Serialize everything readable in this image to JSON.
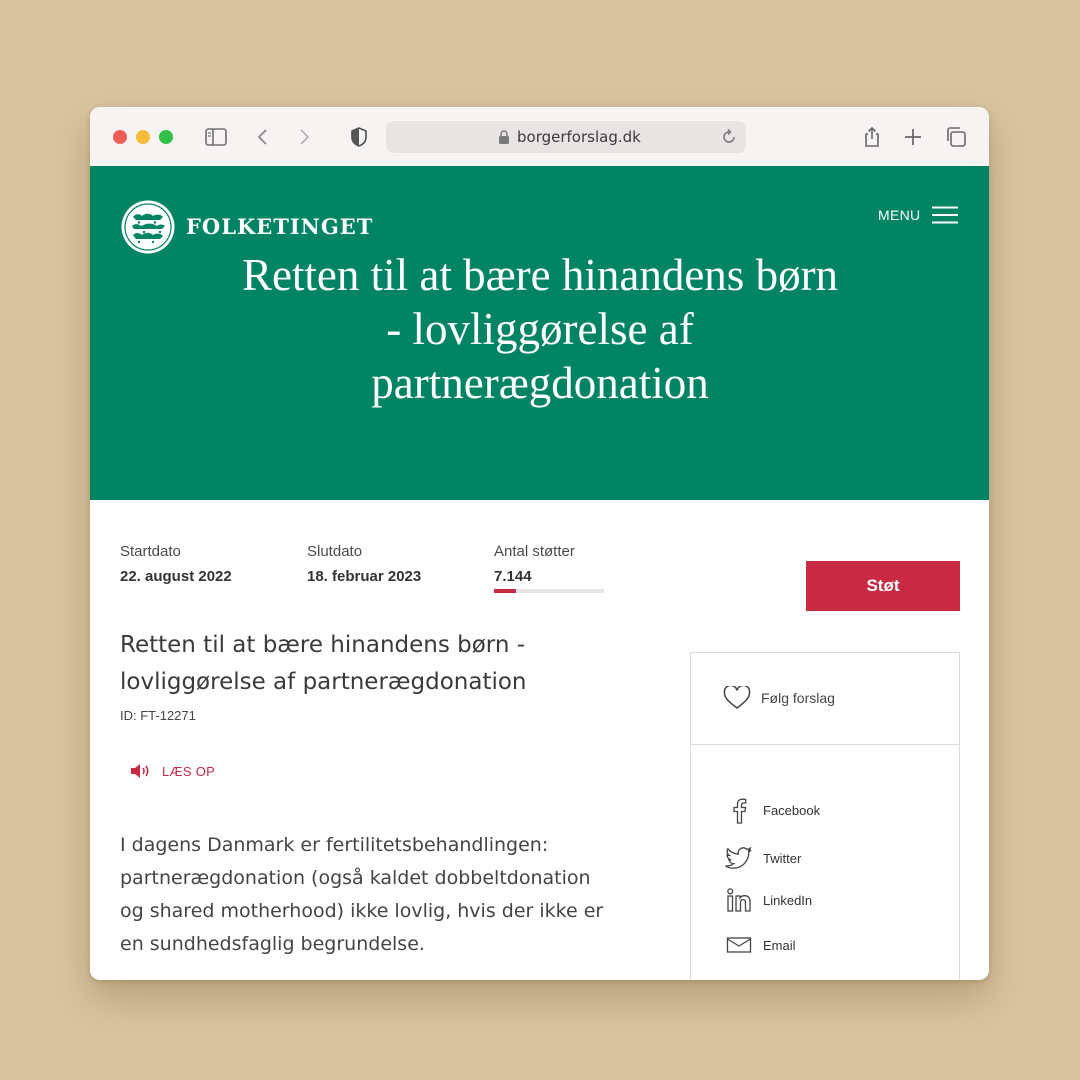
{
  "browser": {
    "url": "borgerforslag.dk"
  },
  "site": {
    "logo_text": "FOLKETINGET",
    "menu_label": "MENU",
    "hero_title": "Retten til at bære hinandens børn - lovliggørelse af partnerægdonation",
    "brand_color": "#008463",
    "accent_color": "#c82a44"
  },
  "stats": {
    "start_label": "Startdato",
    "start_value": "22. august 2022",
    "end_label": "Slutdato",
    "end_value": "18. februar 2023",
    "supporters_label": "Antal støtter",
    "supporters_value": "7.144",
    "supporters_progress_fraction": 0.2
  },
  "actions": {
    "support_label": "Støt",
    "read_aloud_label": "LÆS OP"
  },
  "proposal": {
    "title": "Retten til at bære hinandens børn - lovliggørelse af partnerægdonation",
    "id_label": "ID: FT-12271",
    "body": "I dagens Danmark er fertilitetsbehandlingen: partnerægdonation (også kaldet dobbeltdonation og shared motherhood) ikke lovlig, hvis der ikke er en sundhedsfaglig begrundelse."
  },
  "sidebar": {
    "follow_label": "Følg forslag",
    "share": [
      {
        "label": "Facebook",
        "icon": "facebook-icon"
      },
      {
        "label": "Twitter",
        "icon": "twitter-icon"
      },
      {
        "label": "LinkedIn",
        "icon": "linkedin-icon"
      },
      {
        "label": "Email",
        "icon": "email-icon"
      }
    ]
  }
}
